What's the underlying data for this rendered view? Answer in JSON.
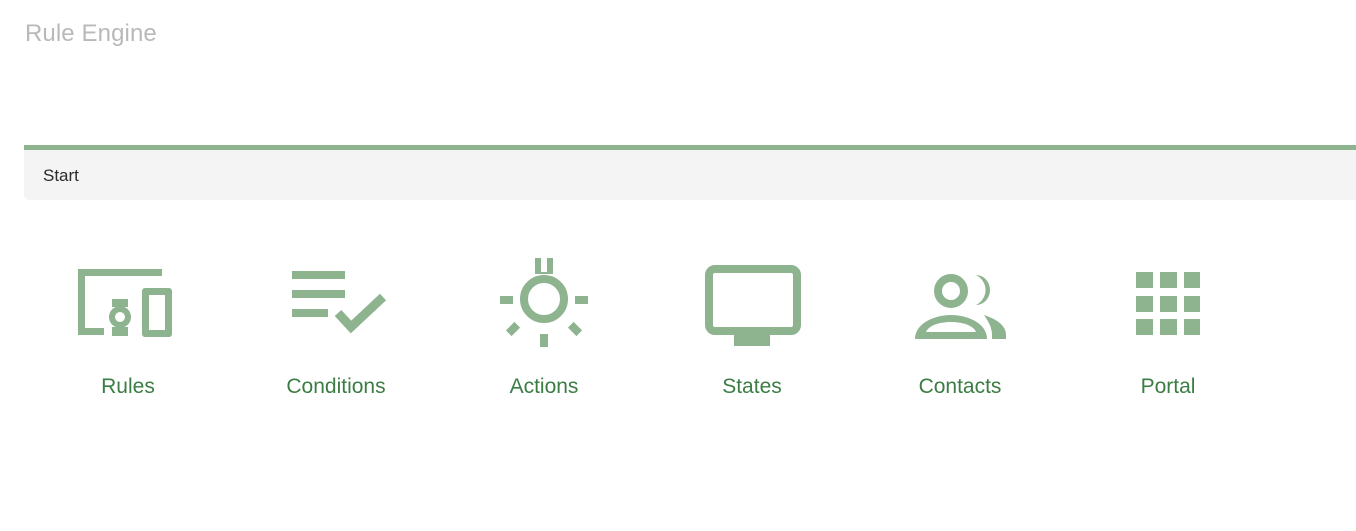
{
  "app": {
    "title": "Rule Engine"
  },
  "breadcrumb": {
    "current": "Start"
  },
  "colors": {
    "accent": "#8db38f",
    "label": "#3b7d44",
    "title": "#b9b9b9",
    "breadcrumb_bg": "#f4f4f4"
  },
  "tiles": [
    {
      "label": "Rules",
      "icon": "devices-icon"
    },
    {
      "label": "Conditions",
      "icon": "checklist-icon"
    },
    {
      "label": "Actions",
      "icon": "lightbulb-icon"
    },
    {
      "label": "States",
      "icon": "monitor-icon"
    },
    {
      "label": "Contacts",
      "icon": "contacts-icon"
    },
    {
      "label": "Portal",
      "icon": "grid-icon"
    }
  ]
}
